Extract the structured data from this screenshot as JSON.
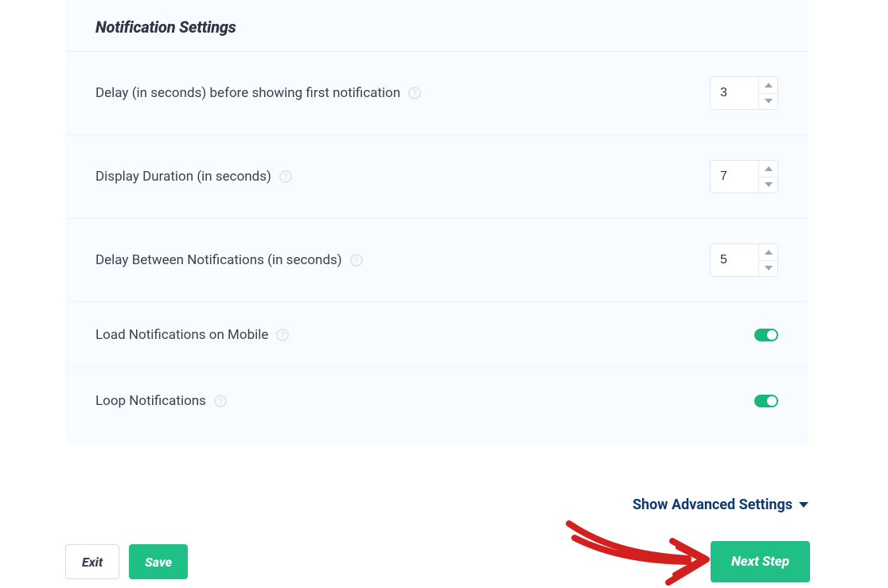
{
  "panel": {
    "title": "Notification Settings",
    "settings": [
      {
        "label": "Delay (in seconds) before showing first notification",
        "value": "3",
        "control": "number"
      },
      {
        "label": "Display Duration (in seconds)",
        "value": "7",
        "control": "number"
      },
      {
        "label": "Delay Between Notifications (in seconds)",
        "value": "5",
        "control": "number"
      },
      {
        "label": "Load Notifications on Mobile",
        "value": "on",
        "control": "toggle"
      },
      {
        "label": "Loop Notifications",
        "value": "on",
        "control": "toggle"
      }
    ]
  },
  "advanced_link": "Show Advanced Settings",
  "actions": {
    "exit": "Exit",
    "save": "Save",
    "next": "Next Step"
  }
}
